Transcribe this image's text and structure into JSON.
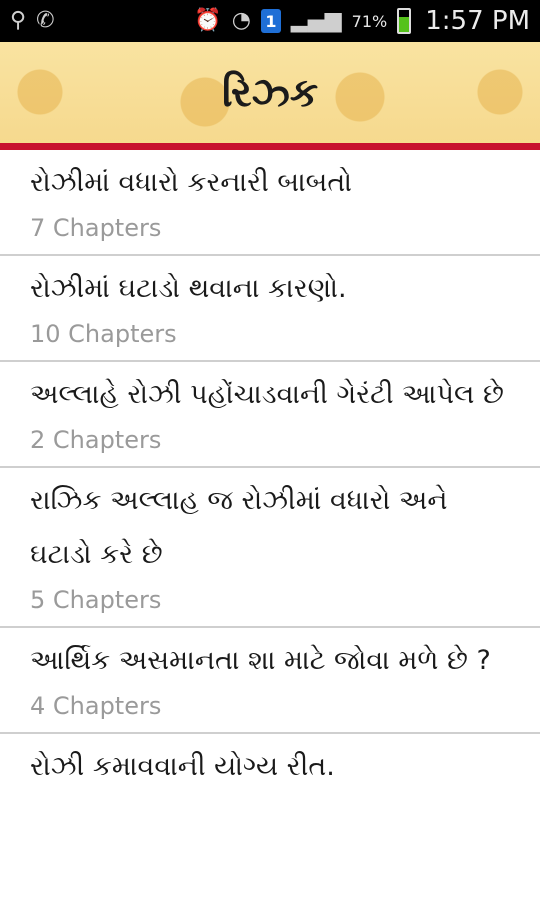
{
  "status_bar": {
    "icons_left": [
      "usb-icon",
      "whatsapp-icon"
    ],
    "notification_badge": "1",
    "battery_percent": "71%",
    "time": "1:57 PM"
  },
  "app_bar": {
    "title": "રિઝ્ક"
  },
  "items": [
    {
      "title": "રોઝીમાં વધારો કરનારી બાબતો",
      "subtitle": "7 Chapters"
    },
    {
      "title": "રોઝીમાં ઘટાડો થવાના કારણો.",
      "subtitle": "10 Chapters"
    },
    {
      "title": "અલ્લાહે રોઝી પહોંચાડવાની ગેરંટી આપેલ છે",
      "subtitle": "2 Chapters"
    },
    {
      "title": "રાઝિક અલ્લાહ જ રોઝીમાં વધારો અને ઘટાડો કરે છે",
      "subtitle": "5 Chapters"
    },
    {
      "title": "આર્થિક અસમાનતા શા માટે જોવા મળે છે ?",
      "subtitle": "4 Chapters"
    },
    {
      "title": "રોઝી કમાવવાની યોગ્ય રીત.",
      "subtitle": ""
    }
  ]
}
